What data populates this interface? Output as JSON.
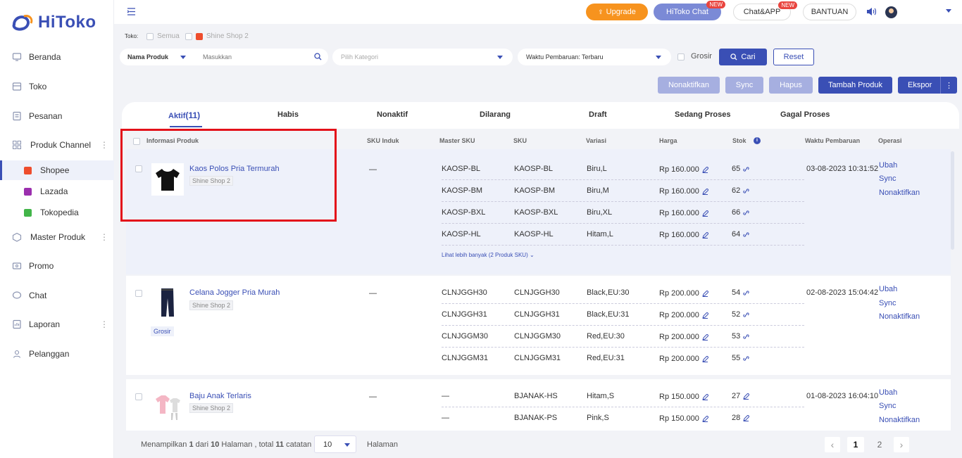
{
  "app": {
    "logo_text": "HiToko",
    "brand_color": "#3a4fb5",
    "accent_color": "#f7931e",
    "highlight_color": "#e3111a"
  },
  "sidebar": {
    "items": [
      {
        "label": "Beranda",
        "icon": "home-icon"
      },
      {
        "label": "Toko",
        "icon": "store-icon"
      },
      {
        "label": "Pesanan",
        "icon": "orders-icon"
      },
      {
        "label": "Produk Channel",
        "icon": "grid-icon"
      },
      {
        "label": "Master Produk",
        "icon": "box-icon"
      },
      {
        "label": "Promo",
        "icon": "promo-icon"
      },
      {
        "label": "Chat",
        "icon": "chat-icon"
      },
      {
        "label": "Laporan",
        "icon": "report-icon"
      },
      {
        "label": "Pelanggan",
        "icon": "customers-icon"
      }
    ],
    "channels": [
      {
        "label": "Shopee",
        "color": "#ee4d2d"
      },
      {
        "label": "Lazada",
        "color": "#9b2fae"
      },
      {
        "label": "Tokopedia",
        "color": "#42b549"
      }
    ]
  },
  "topbar": {
    "upgrade": "Upgrade",
    "hitoko_chat": "HiToko Chat",
    "chat_app": "Chat&APP",
    "bantuan": "BANTUAN",
    "new_badge": "NEW"
  },
  "filters": {
    "toko_label": "Toko:",
    "semua": "Semua",
    "shop": "Shine Shop 2",
    "nama_produk": "Nama Produk",
    "search_placeholder": "Masukkan",
    "kategori_placeholder": "Pilih Kategori",
    "waktu": "Waktu Pembaruan: Terbaru",
    "grosir": "Grosir",
    "cari": "Cari",
    "reset": "Reset"
  },
  "actions": {
    "nonaktifkan": "Nonaktifkan",
    "sync": "Sync",
    "hapus": "Hapus",
    "tambah": "Tambah Produk",
    "ekspor": "Ekspor"
  },
  "tabs": [
    {
      "label": "Aktif",
      "count": "(11)"
    },
    {
      "label": "Habis"
    },
    {
      "label": "Nonaktif"
    },
    {
      "label": "Dilarang"
    },
    {
      "label": "Draft"
    },
    {
      "label": "Sedang Proses"
    },
    {
      "label": "Gagal Proses"
    }
  ],
  "table_headers": {
    "info": "Informasi Produk",
    "sku_induk": "SKU Induk",
    "master_sku": "Master SKU",
    "sku": "SKU",
    "variasi": "Variasi",
    "harga": "Harga",
    "stok": "Stok",
    "waktu": "Waktu Pembaruan",
    "operasi": "Operasi"
  },
  "products": [
    {
      "name": "Kaos Polos Pria Termurah",
      "shop": "Shine Shop 2",
      "sku_induk": "—",
      "time": "03-08-2023 10:31:52",
      "more": "Lihat lebih banyak (2 Produk SKU)",
      "rows": [
        {
          "master": "KAOSP-BL",
          "sku": "KAOSP-BL",
          "var": "Biru,L",
          "price": "Rp 160.000",
          "stock": "65"
        },
        {
          "master": "KAOSP-BM",
          "sku": "KAOSP-BM",
          "var": "Biru,M",
          "price": "Rp 160.000",
          "stock": "62"
        },
        {
          "master": "KAOSP-BXL",
          "sku": "KAOSP-BXL",
          "var": "Biru,XL",
          "price": "Rp 160.000",
          "stock": "66"
        },
        {
          "master": "KAOSP-HL",
          "sku": "KAOSP-HL",
          "var": "Hitam,L",
          "price": "Rp 160.000",
          "stock": "64"
        }
      ]
    },
    {
      "name": "Celana Jogger Pria Murah",
      "shop": "Shine Shop 2",
      "tag": "Grosir",
      "sku_induk": "—",
      "time": "02-08-2023 15:04:42",
      "rows": [
        {
          "master": "CLNJGGH30",
          "sku": "CLNJGGH30",
          "var": "Black,EU:30",
          "price": "Rp 200.000",
          "stock": "54"
        },
        {
          "master": "CLNJGGH31",
          "sku": "CLNJGGH31",
          "var": "Black,EU:31",
          "price": "Rp 200.000",
          "stock": "52"
        },
        {
          "master": "CLNJGGM30",
          "sku": "CLNJGGM30",
          "var": "Red,EU:30",
          "price": "Rp 200.000",
          "stock": "53"
        },
        {
          "master": "CLNJGGM31",
          "sku": "CLNJGGM31",
          "var": "Red,EU:31",
          "price": "Rp 200.000",
          "stock": "55"
        }
      ]
    },
    {
      "name": "Baju Anak Terlaris",
      "shop": "Shine Shop 2",
      "sku_induk": "—",
      "time": "01-08-2023 16:04:10",
      "rows": [
        {
          "master": "—",
          "sku": "BJANAK-HS",
          "var": "Hitam,S",
          "price": "Rp 150.000",
          "stock": "27"
        },
        {
          "master": "—",
          "sku": "BJANAK-PS",
          "var": "Pink,S",
          "price": "Rp 150.000",
          "stock": "28"
        }
      ]
    }
  ],
  "operations": {
    "ubah": "Ubah",
    "sync": "Sync",
    "nonaktifkan": "Nonaktifkan"
  },
  "footer": {
    "showing_pre": "Menampilkan ",
    "page": "1",
    "mid1": " dari ",
    "pages": "10",
    "mid2": " Halaman , total ",
    "total": "11",
    "post": " catatan",
    "page_size": "10",
    "halaman": "Halaman",
    "prev": "‹",
    "next": "›",
    "page_numbers": [
      "1",
      "2"
    ]
  }
}
